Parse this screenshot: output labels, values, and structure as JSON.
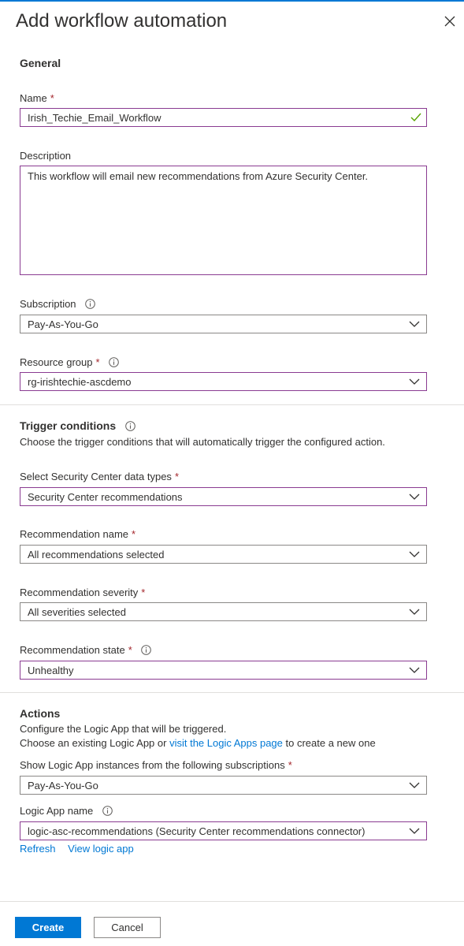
{
  "header": {
    "title": "Add workflow automation"
  },
  "general": {
    "section_label": "General",
    "name": {
      "label": "Name",
      "value": "Irish_Techie_Email_Workflow"
    },
    "description": {
      "label": "Description",
      "value": "This workflow will email new recommendations from Azure Security Center."
    },
    "subscription": {
      "label": "Subscription",
      "value": "Pay-As-You-Go"
    },
    "resource_group": {
      "label": "Resource group",
      "value": "rg-irishtechie-ascdemo"
    }
  },
  "trigger": {
    "section_label": "Trigger conditions",
    "description": "Choose the trigger conditions that will automatically trigger the configured action.",
    "data_types": {
      "label": "Select Security Center data types",
      "value": "Security Center recommendations"
    },
    "rec_name": {
      "label": "Recommendation name",
      "value": "All recommendations selected"
    },
    "rec_severity": {
      "label": "Recommendation severity",
      "value": "All severities selected"
    },
    "rec_state": {
      "label": "Recommendation state",
      "value": "Unhealthy"
    }
  },
  "actions": {
    "section_label": "Actions",
    "desc_line1": "Configure the Logic App that will be triggered.",
    "desc_line2_prefix": "Choose an existing Logic App or ",
    "desc_line2_link": "visit the Logic Apps page",
    "desc_line2_suffix": " to create a new one",
    "show_instances": {
      "label": "Show Logic App instances from the following subscriptions",
      "value": "Pay-As-You-Go"
    },
    "logic_app_name": {
      "label": "Logic App name",
      "value": "logic-asc-recommendations (Security Center recommendations connector)"
    },
    "refresh_link": "Refresh",
    "view_link": "View logic app"
  },
  "footer": {
    "create_label": "Create",
    "cancel_label": "Cancel"
  },
  "required_marker": "*",
  "colors": {
    "accent": "#0078d4",
    "focus_border": "#8a3b91",
    "required": "#a4262c",
    "success": "#57a300"
  }
}
